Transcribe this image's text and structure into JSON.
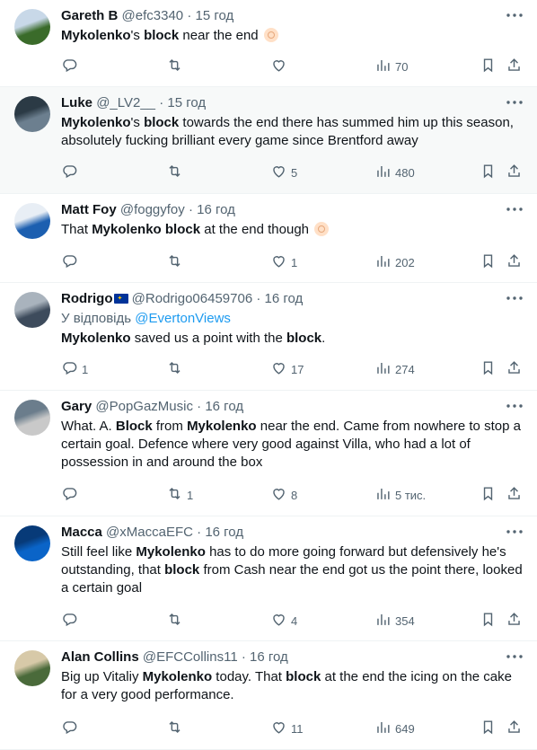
{
  "tweets": [
    {
      "name": "Gareth B",
      "handle": "@efc3340",
      "time": "15 год",
      "text_html": "<b>Mykolenko</b>'s <b>block</b> near the end <span class=\"emoji\" data-name=\"ok-hand-emoji\" data-interactable=\"false\"></span>",
      "replies": "",
      "retweets": "",
      "likes": "",
      "views": "70",
      "avatar_colors": [
        "#3a6b2a",
        "#c8d8e8"
      ]
    },
    {
      "name": "Luke",
      "handle": "@_LV2__",
      "time": "15 год",
      "text_html": "<b>Mykolenko</b>'s <b>block</b> towards the end there has summed him up this season, absolutely fucking brilliant every game since Brentford away",
      "replies": "",
      "retweets": "",
      "likes": "5",
      "views": "480",
      "avatar_colors": [
        "#6c7f8f",
        "#2b3a45"
      ]
    },
    {
      "name": "Matt Foy",
      "handle": "@foggyfoy",
      "time": "16 год",
      "text_html": "That <b>Mykolenko</b> <b>block</b> at the end though <span class=\"emoji\" data-name=\"point-up-emoji\" data-interactable=\"false\"></span>",
      "replies": "",
      "retweets": "",
      "likes": "1",
      "views": "202",
      "avatar_colors": [
        "#1c5fb0",
        "#e8eef5"
      ]
    },
    {
      "name": "Rodrigo",
      "handle": "@Rodrigo06459706",
      "time": "16 год",
      "reply_prefix": "У відповідь",
      "reply_to": "@EvertonViews",
      "text_html": "<b>Mykolenko</b> saved us a point with the <b>block</b>.",
      "replies": "1",
      "retweets": "",
      "likes": "17",
      "views": "274",
      "avatar_colors": [
        "#3d4b5c",
        "#a9b3bd"
      ]
    },
    {
      "name": "Gary",
      "handle": "@PopGazMusic",
      "time": "16 год",
      "text_html": "What. A. <b>Block</b> from <b>Mykolenko</b> near the end. Came from nowhere to stop a certain goal. Defence where very good against Villa, who had a lot of possession in and around the box",
      "replies": "",
      "retweets": "1",
      "likes": "8",
      "views": "5 тис.",
      "avatar_colors": [
        "#c9c9c9",
        "#6b7d8c"
      ]
    },
    {
      "name": "Macca",
      "handle": "@xMaccaEFC",
      "time": "16 год",
      "text_html": "Still feel like <b>Mykolenko</b> has to do more going forward but defensively he's outstanding, that <b>block</b> from Cash near the end got us the point there, looked a certain goal",
      "replies": "",
      "retweets": "",
      "likes": "4",
      "views": "354",
      "avatar_colors": [
        "#0a64c8",
        "#073a78"
      ]
    },
    {
      "name": "Alan Collins",
      "handle": "@EFCCollins11",
      "time": "16 год",
      "text_html": "Big up Vitaliy <b>Mykolenko</b> today. That <b>block</b> at the end the icing on the cake for a very good performance.",
      "replies": "",
      "retweets": "",
      "likes": "11",
      "views": "649",
      "avatar_colors": [
        "#4a6a3a",
        "#d7c9a8"
      ]
    }
  ]
}
